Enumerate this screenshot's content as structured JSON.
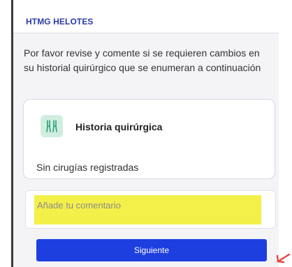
{
  "header": {
    "title": "HTMG HELOTES"
  },
  "intro": {
    "text": "Por favor revise y comente si se requieren cambios en su historial quirúrgico que se enumeran a continuación"
  },
  "card": {
    "icon": "surgical-tools-icon",
    "title": "Historia quirúrgica",
    "empty_text": "Sin cirugías registradas"
  },
  "comment": {
    "placeholder": "Añade tu comentario",
    "value": ""
  },
  "actions": {
    "next_label": "Siguiente"
  },
  "colors": {
    "brand": "#2b3aa6",
    "button": "#1d3fe0",
    "highlight": "#f4f04a",
    "annotation_arrow": "#e8453c",
    "icon_bg": "#cfeee0"
  },
  "annotation": {
    "icon": "arrow-pointer-icon"
  }
}
